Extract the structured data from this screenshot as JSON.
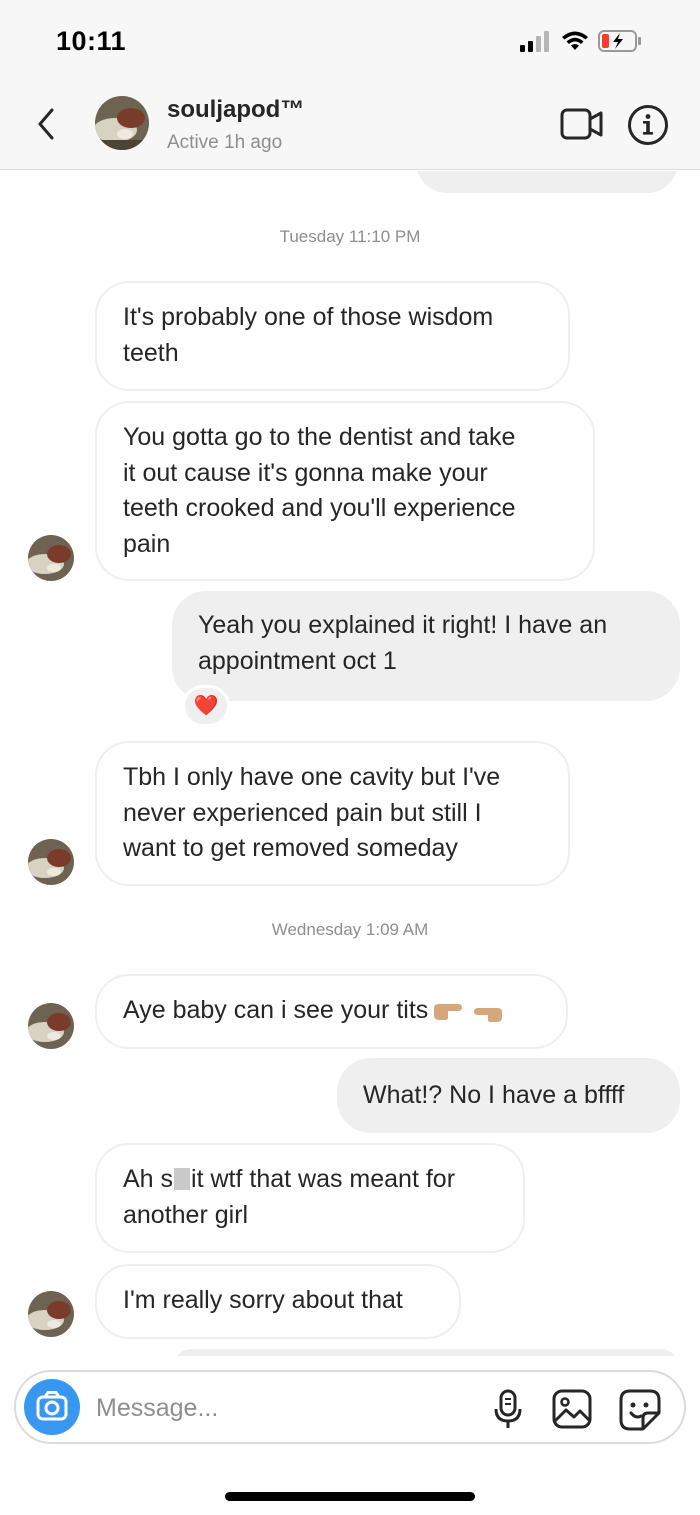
{
  "status_bar": {
    "time": "10:11"
  },
  "header": {
    "contact_name": "souljapod™",
    "active_status": "Active 1h ago"
  },
  "icons": {
    "back": "chevron-left-icon",
    "video": "video-camera-icon",
    "info": "info-icon",
    "camera": "camera-icon",
    "mic": "microphone-icon",
    "gallery": "image-icon",
    "sticker": "sticker-icon"
  },
  "colors": {
    "accent": "#3897f0",
    "outgoing_bubble": "#efefef",
    "heart": "#e0245e"
  },
  "thread": {
    "timestamp_1": "Tuesday 11:10 PM",
    "timestamp_2": "Wednesday 1:09 AM",
    "messages": [
      {
        "sender": "contact",
        "lines": [
          "It's probably one of those wisdom",
          "teeth"
        ]
      },
      {
        "sender": "contact",
        "lines": [
          "You gotta go to the dentist and take",
          "it out cause it's gonna make your",
          "teeth crooked and you'll experience",
          "pain"
        ]
      },
      {
        "sender": "me",
        "lines": [
          "Yeah you explained it right! I have an",
          "appointment oct 1"
        ],
        "reaction": "❤️"
      },
      {
        "sender": "contact",
        "lines": [
          "Tbh I only have one cavity but I've",
          "never experienced pain but still I",
          "want to get removed someday"
        ]
      },
      {
        "sender": "contact",
        "lines": [
          "Aye baby can i see your tits"
        ]
      },
      {
        "sender": "me",
        "lines": [
          "What!? No I have a bffff"
        ]
      },
      {
        "sender": "contact",
        "lines": [
          "Ah s",
          "it wtf that was meant for",
          "another girl"
        ]
      },
      {
        "sender": "contact",
        "lines": [
          "I'm really sorry about that"
        ]
      }
    ]
  },
  "composer": {
    "placeholder": "Message..."
  }
}
